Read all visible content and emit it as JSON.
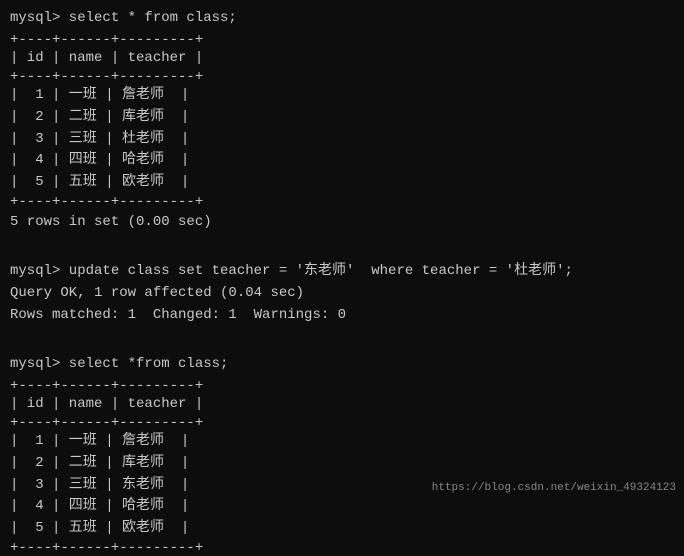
{
  "terminal": {
    "query1": "mysql> select * from class;",
    "table1": {
      "hline": "+----+------+---------+",
      "header_id": " id ",
      "header_name": " name ",
      "header_teacher": " teacher ",
      "rows": [
        {
          "id": " 1 ",
          "name": " 一班 ",
          "teacher": " 詹老师 "
        },
        {
          "id": " 2 ",
          "name": " 二班 ",
          "teacher": " 库老师 "
        },
        {
          "id": " 3 ",
          "name": " 三班 ",
          "teacher": " 杜老师 "
        },
        {
          "id": " 4 ",
          "name": " 四班 ",
          "teacher": " 哈老师 "
        },
        {
          "id": " 5 ",
          "name": " 五班 ",
          "teacher": " 欧老师 "
        }
      ]
    },
    "rows_info": "5 rows in set (0.00 sec)",
    "query2": "mysql> update class set teacher = '东老师'  where teacher = '杜老师';",
    "query_ok": "Query OK, 1 row affected (0.04 sec)",
    "rows_matched": "Rows matched: 1  Changed: 1  Warnings: 0",
    "query3": "mysql> select *from class;",
    "table2": {
      "hline": "+----+------+---------+",
      "header_id": " id ",
      "header_name": " name ",
      "header_teacher": " teacher ",
      "rows": [
        {
          "id": " 1 ",
          "name": " 一班 ",
          "teacher": " 詹老师 "
        },
        {
          "id": " 2 ",
          "name": " 二班 ",
          "teacher": " 库老师 "
        },
        {
          "id": " 3 ",
          "name": " 三班 ",
          "teacher": " 东老师 "
        },
        {
          "id": " 4 ",
          "name": " 四班 ",
          "teacher": " 哈老师 "
        },
        {
          "id": " 5 ",
          "name": " 五班 ",
          "teacher": " 欧老师 "
        }
      ]
    },
    "rows_info2": "",
    "watermark": "https://blog.csdn.net/weixin_49324123"
  }
}
